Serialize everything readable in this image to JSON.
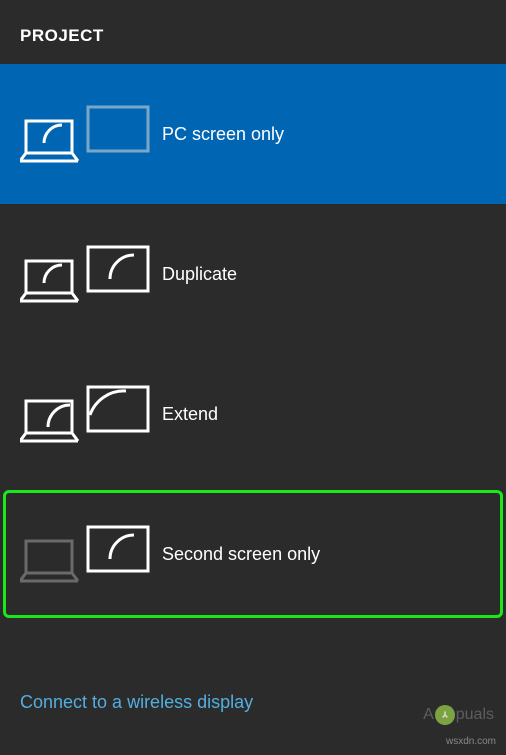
{
  "header": {
    "title": "PROJECT"
  },
  "options": [
    {
      "id": "pc-screen-only",
      "label": "PC screen only",
      "selected": true,
      "highlighted": false
    },
    {
      "id": "duplicate",
      "label": "Duplicate",
      "selected": false,
      "highlighted": false
    },
    {
      "id": "extend",
      "label": "Extend",
      "selected": false,
      "highlighted": false
    },
    {
      "id": "second-screen-only",
      "label": "Second screen only",
      "selected": false,
      "highlighted": true
    }
  ],
  "footer": {
    "connect_label": "Connect to a wireless display"
  },
  "watermark": {
    "source": "wsxdn.com",
    "logo_prefix": "A",
    "logo_suffix": "puals"
  },
  "chart_data": null
}
